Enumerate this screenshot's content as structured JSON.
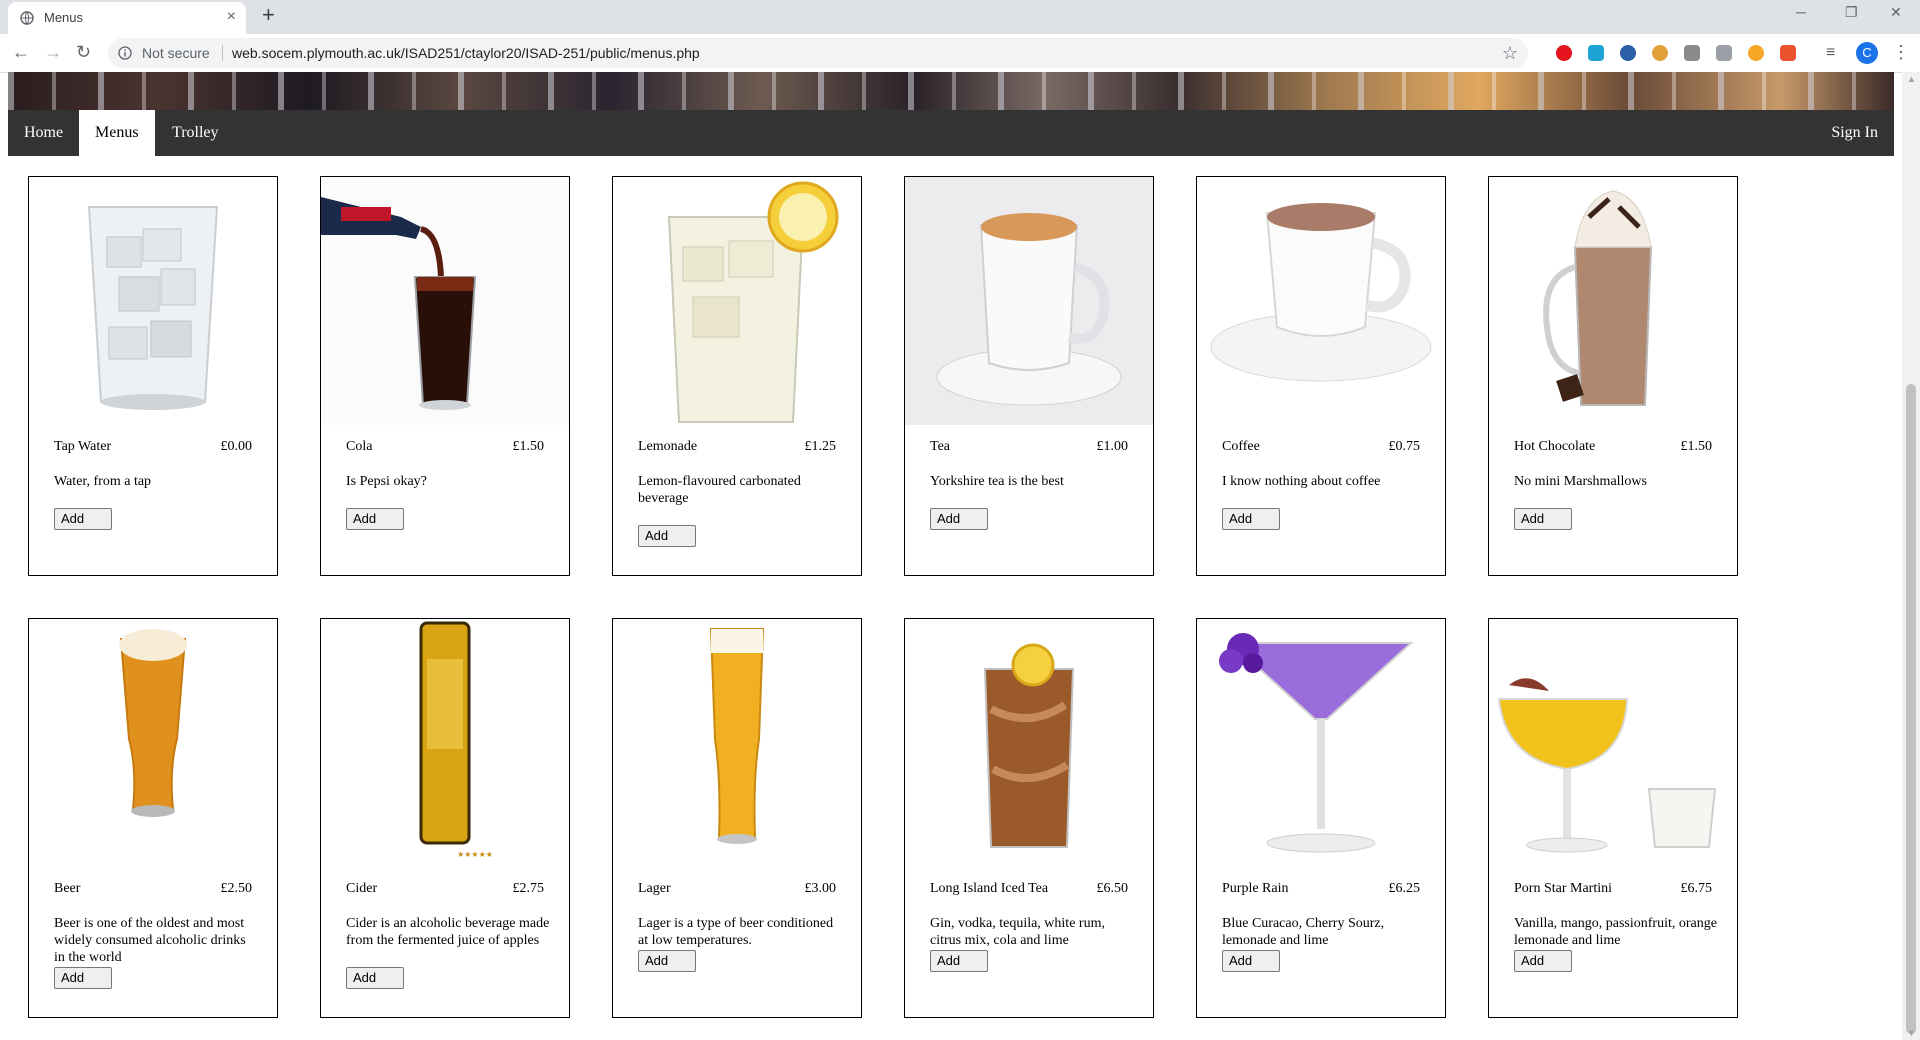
{
  "browser": {
    "tab_title": "Menus",
    "new_tab_label": "+",
    "tab_close_label": "×",
    "security_label": "Not secure",
    "url": "web.socem.plymouth.ac.uk/ISAD251/ctaylor20/ISAD-251/public/menus.php",
    "profile_initial": "C",
    "window_controls": {
      "minimize": "─",
      "restore": "❐",
      "close": "✕"
    }
  },
  "nav": {
    "home": "Home",
    "menus": "Menus",
    "trolley": "Trolley",
    "sign_in": "Sign In"
  },
  "products": [
    {
      "name": "Tap Water",
      "price": "£0.00",
      "description": "Water, from a tap",
      "button": "Add",
      "image_icon": "water-glass-icon"
    },
    {
      "name": "Cola",
      "price": "£1.50",
      "description": "Is Pepsi okay?",
      "button": "Add",
      "image_icon": "cola-glass-icon"
    },
    {
      "name": "Lemonade",
      "price": "£1.25",
      "description": "Lemon-flavoured carbonated beverage",
      "button": "Add",
      "image_icon": "lemonade-glass-icon"
    },
    {
      "name": "Tea",
      "price": "£1.00",
      "description": "Yorkshire tea is the best",
      "button": "Add",
      "image_icon": "tea-cup-icon"
    },
    {
      "name": "Coffee",
      "price": "£0.75",
      "description": "I know nothing about coffee",
      "button": "Add",
      "image_icon": "coffee-cup-icon"
    },
    {
      "name": "Hot Chocolate",
      "price": "£1.50",
      "description": "No mini Marshmallows",
      "button": "Add",
      "image_icon": "hot-chocolate-glass-icon"
    },
    {
      "name": "Beer",
      "price": "£2.50",
      "description": "Beer is one of the oldest and most widely consumed alcoholic drinks in the world",
      "button": "Add",
      "image_icon": "beer-glass-icon"
    },
    {
      "name": "Cider",
      "price": "£2.75",
      "description": "Cider is an alcoholic beverage made from the fermented juice of apples",
      "button": "Add",
      "image_icon": "cider-bottle-icon"
    },
    {
      "name": "Lager",
      "price": "£3.00",
      "description": "Lager is a type of beer conditioned at low temperatures.",
      "button": "Add",
      "image_icon": "lager-glass-icon"
    },
    {
      "name": "Long Island Iced Tea",
      "price": "£6.50",
      "description": "Gin, vodka, tequila, white rum, citrus mix, cola and lime",
      "button": "Add",
      "image_icon": "iced-tea-glass-icon"
    },
    {
      "name": "Purple Rain",
      "price": "£6.25",
      "description": "Blue Curacao, Cherry Sourz, lemonade and lime",
      "button": "Add",
      "image_icon": "martini-glass-icon"
    },
    {
      "name": "Porn Star Martini",
      "price": "£6.75",
      "description": "Vanilla, mango, passionfruit, orange lemonade and lime",
      "button": "Add",
      "image_icon": "coupe-glass-icon"
    }
  ],
  "colors": {
    "nav_bg": "#333333",
    "nav_active_bg": "#ffffff",
    "card_border": "#000000"
  }
}
